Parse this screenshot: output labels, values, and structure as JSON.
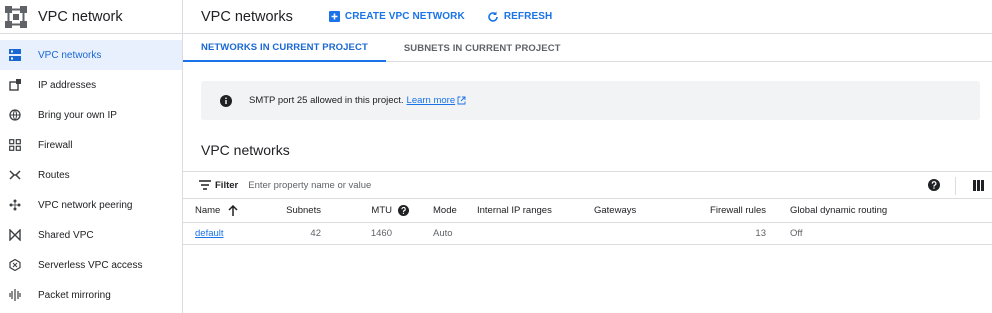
{
  "sidebar": {
    "title": "VPC network",
    "items": [
      {
        "label": "VPC networks",
        "icon": "vpc-networks-icon",
        "active": true
      },
      {
        "label": "IP addresses",
        "icon": "ip-addresses-icon"
      },
      {
        "label": "Bring your own IP",
        "icon": "globe-icon"
      },
      {
        "label": "Firewall",
        "icon": "firewall-icon"
      },
      {
        "label": "Routes",
        "icon": "routes-icon"
      },
      {
        "label": "VPC network peering",
        "icon": "peering-icon"
      },
      {
        "label": "Shared VPC",
        "icon": "shared-vpc-icon"
      },
      {
        "label": "Serverless VPC access",
        "icon": "serverless-icon"
      },
      {
        "label": "Packet mirroring",
        "icon": "packet-mirroring-icon"
      }
    ]
  },
  "header": {
    "title": "VPC networks",
    "create_label": "CREATE VPC NETWORK",
    "refresh_label": "REFRESH"
  },
  "tabs": [
    {
      "label": "NETWORKS IN CURRENT PROJECT",
      "active": true
    },
    {
      "label": "SUBNETS IN CURRENT PROJECT"
    }
  ],
  "banner": {
    "text": "SMTP port 25 allowed in this project.",
    "link": "Learn more"
  },
  "section_title": "VPC networks",
  "filter": {
    "label": "Filter",
    "placeholder": "Enter property name or value"
  },
  "table": {
    "columns": [
      "Name",
      "Subnets",
      "MTU",
      "Mode",
      "Internal IP ranges",
      "Gateways",
      "Firewall rules",
      "Global dynamic routing"
    ],
    "rows": [
      {
        "name": "default",
        "subnets": "42",
        "mtu": "1460",
        "mode": "Auto",
        "internal_ip_ranges": "",
        "gateways": "",
        "firewall_rules": "13",
        "global_dynamic_routing": "Off"
      }
    ]
  },
  "colors": {
    "accent": "#1a73e8",
    "active_bg": "#e8f0fe",
    "banner_bg": "#f1f3f4",
    "border": "#dadce0"
  }
}
